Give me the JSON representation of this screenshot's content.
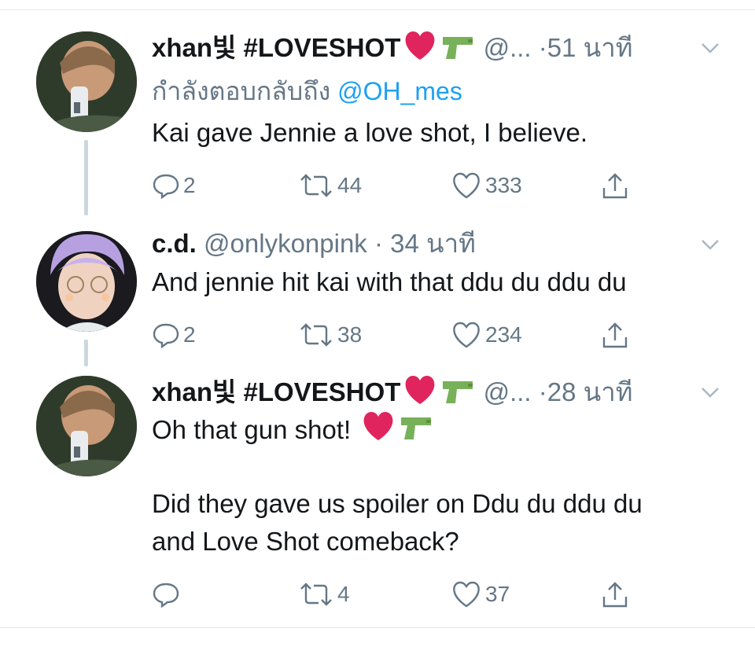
{
  "tweets": [
    {
      "name": "xhan빛 #LOVESHOT",
      "handle": "@...",
      "time": "51 นาที",
      "reply_prefix": "กำลังตอบกลับถึง",
      "reply_mention": "@OH_mes",
      "text": "Kai gave Jennie a love shot, I believe.",
      "replies": "2",
      "retweets": "44",
      "likes": "333"
    },
    {
      "name": "c.d.",
      "handle": "@onlykonpink",
      "time": "34 นาที",
      "text": "And jennie hit kai with that ddu du ddu du",
      "replies": "2",
      "retweets": "38",
      "likes": "234"
    },
    {
      "name": "xhan빛 #LOVESHOT",
      "handle": "@...",
      "time": "28 นาที",
      "text_line1": "Oh that gun shot!",
      "text_line2": "Did they gave us spoiler on Ddu du ddu du",
      "text_line3": "and Love Shot comeback?",
      "replies": "",
      "retweets": "4",
      "likes": "37"
    }
  ],
  "separator_dot": "·",
  "icons": [
    "heart-emoji-icon",
    "water-gun-emoji-icon",
    "chevron-down-icon",
    "reply-icon",
    "retweet-icon",
    "like-icon",
    "share-icon"
  ],
  "colors": {
    "text": "#14171a",
    "secondary": "#657786",
    "mention": "#1da1f2",
    "heart": "#e0245e",
    "gun": "#78b159"
  }
}
